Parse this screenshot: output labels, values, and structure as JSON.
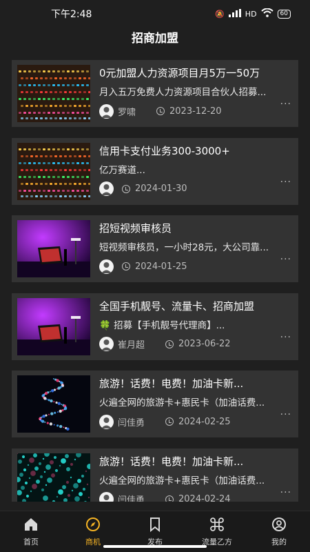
{
  "status": {
    "time": "下午2:48",
    "signal_hd": "HD",
    "battery": "60"
  },
  "header": {
    "title": "招商加盟"
  },
  "cards": [
    {
      "title": "0元加盟人力资源项目月5万一50万",
      "desc": "月入五万免费人力资源项目合伙人招募...",
      "author": "罗啸",
      "date": "2023-12-20",
      "thumb": "equalizer"
    },
    {
      "title": "信用卡支付业务300-3000+",
      "desc": "亿万赛道...",
      "author": "",
      "date": "2024-01-30",
      "thumb": "equalizer"
    },
    {
      "title": "招短视频审核员",
      "desc": "短视频审核员，一小时28元，大公司靠...",
      "author": "",
      "date": "2024-01-25",
      "thumb": "desk"
    },
    {
      "title": "全国手机靓号、流量卡、招商加盟",
      "desc": "🍀 招募【手机靓号代理商】...",
      "author": "崔月超",
      "date": "2023-06-22",
      "thumb": "desk"
    },
    {
      "title": "旅游！话费！电费！加油卡新...",
      "desc": "火遍全网的旅游卡+惠民卡（加油话费...",
      "author": "闫佳勇",
      "date": "2024-02-25",
      "thumb": "fiber"
    },
    {
      "title": "旅游！话费！电费！加油卡新...",
      "desc": "火遍全网的旅游卡+惠民卡（加油话费...",
      "author": "闫佳勇",
      "date": "2024-02-24",
      "thumb": "fiber2"
    }
  ],
  "tabs": [
    {
      "label": "首页",
      "icon": "home-icon",
      "active": false
    },
    {
      "label": "商机",
      "icon": "compass-icon",
      "active": true
    },
    {
      "label": "发布",
      "icon": "bookmark-icon",
      "active": false
    },
    {
      "label": "流量乙方",
      "icon": "command-icon",
      "active": false
    },
    {
      "label": "我的",
      "icon": "profile-icon",
      "active": false
    }
  ],
  "colors": {
    "background": "#1f1f1f",
    "card": "#333333",
    "accent": "#f5b324"
  }
}
